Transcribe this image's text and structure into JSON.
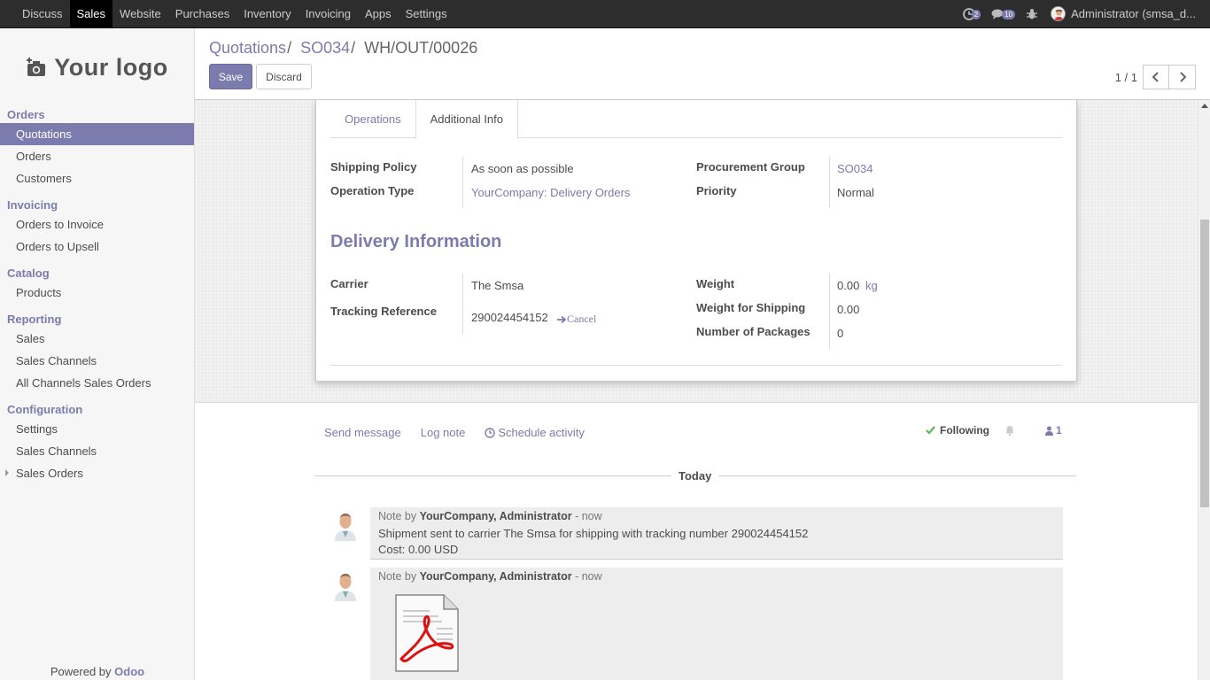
{
  "topbar": {
    "menu": [
      "Discuss",
      "Sales",
      "Website",
      "Purchases",
      "Inventory",
      "Invoicing",
      "Apps",
      "Settings"
    ],
    "active": "Sales",
    "activity_count": "2",
    "messages_count": "10",
    "user": "Administrator (smsa_d..."
  },
  "sidebar": {
    "logo_text": "Your logo",
    "sections": {
      "orders": "Orders",
      "invoicing": "Invoicing",
      "catalog": "Catalog",
      "reporting": "Reporting",
      "configuration": "Configuration"
    },
    "items": {
      "quotations": "Quotations",
      "orders": "Orders",
      "customers": "Customers",
      "orders_to_invoice": "Orders to Invoice",
      "orders_to_upsell": "Orders to Upsell",
      "products": "Products",
      "sales": "Sales",
      "sales_channels": "Sales Channels",
      "all_channels_sales_orders": "All Channels Sales Orders",
      "settings": "Settings",
      "config_sales_channels": "Sales Channels",
      "sales_orders": "Sales Orders"
    },
    "powered_by": "Powered by",
    "brand": "Odoo"
  },
  "control_panel": {
    "breadcrumb": [
      "Quotations",
      "SO034",
      "WH/OUT/00026"
    ],
    "save": "Save",
    "discard": "Discard",
    "pager": "1 / 1"
  },
  "form": {
    "tabs": [
      "Operations",
      "Additional Info"
    ],
    "active_tab": "Additional Info",
    "shipping_policy_label": "Shipping Policy",
    "shipping_policy": "As soon as possible",
    "operation_type_label": "Operation Type",
    "operation_type": "YourCompany: Delivery Orders",
    "procurement_group_label": "Procurement Group",
    "procurement_group": "SO034",
    "priority_label": "Priority",
    "priority": "Normal",
    "delivery_title": "Delivery Information",
    "carrier_label": "Carrier",
    "carrier": "The Smsa",
    "tracking_label": "Tracking Reference",
    "tracking": "290024454152",
    "tracking_cancel": "Cancel",
    "weight_label": "Weight",
    "weight": "0.00",
    "weight_unit": "kg",
    "weight_shipping_label": "Weight for Shipping",
    "weight_shipping": "0.00",
    "packages_label": "Number of Packages",
    "packages": "0"
  },
  "chatter": {
    "send_message": "Send message",
    "log_note": "Log note",
    "schedule_activity": "Schedule activity",
    "following": "Following",
    "followers": "1",
    "today": "Today",
    "messages": [
      {
        "prefix": "Note by",
        "author": "YourCompany, Administrator",
        "when": "- now",
        "line1": "Shipment sent to carrier The Smsa for shipping with tracking number 290024454152",
        "line2": "Cost: 0.00 USD"
      },
      {
        "prefix": "Note by",
        "author": "YourCompany, Administrator",
        "when": "- now"
      }
    ]
  }
}
